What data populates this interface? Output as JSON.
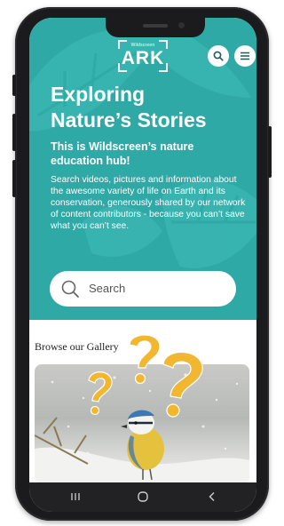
{
  "brand": {
    "logo_small": "Wildscreen",
    "logo_big": "ARK"
  },
  "header": {
    "search_icon": "search-icon",
    "menu_icon": "hamburger-menu-icon"
  },
  "hero": {
    "title_line1": "Exploring",
    "title_line2": "Nature’s Stories",
    "lead": "This is Wildscreen’s nature education hub!",
    "description": "Search videos, pictures and information about the awesome variety of life on Earth and its conservation, generously shared by our network of content contributors - because you can’t save what you can’t see.",
    "search_placeholder": "Search"
  },
  "gallery": {
    "label": "Browse our Gallery",
    "image_subject": "blue tit bird perched in snow"
  },
  "navbar": {
    "recent_icon": "recent-apps-icon",
    "home_icon": "home-icon",
    "back_icon": "back-icon"
  },
  "colors": {
    "hero_background": "#2fa9a6",
    "question_marks": "#f2b731",
    "phone_frame": "#1b1b1d"
  }
}
